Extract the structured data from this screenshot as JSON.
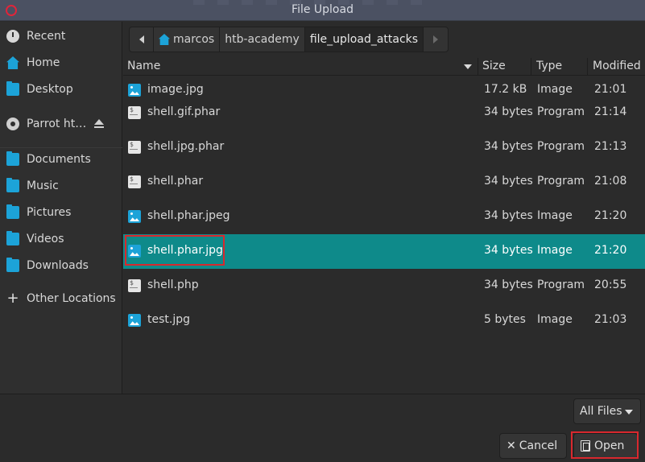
{
  "window": {
    "title": "File Upload"
  },
  "sidebar": {
    "items": [
      {
        "label": "Recent",
        "icon": "recent-icon"
      },
      {
        "label": "Home",
        "icon": "home-icon"
      },
      {
        "label": "Desktop",
        "icon": "folder-icon"
      },
      {
        "label": "Parrot ht…",
        "icon": "disc-icon"
      },
      {
        "label": "Documents",
        "icon": "folder-icon"
      },
      {
        "label": "Music",
        "icon": "folder-icon"
      },
      {
        "label": "Pictures",
        "icon": "folder-icon"
      },
      {
        "label": "Videos",
        "icon": "folder-icon"
      },
      {
        "label": "Downloads",
        "icon": "folder-icon"
      },
      {
        "label": "Other Locations",
        "icon": "plus-icon"
      }
    ]
  },
  "pathbar": {
    "segments": [
      "marcos",
      "htb-academy",
      "file_upload_attacks"
    ]
  },
  "columns": {
    "name": "Name",
    "size": "Size",
    "type": "Type",
    "modified": "Modified"
  },
  "files": [
    {
      "name": "image.jpg",
      "size": "17.2 kB",
      "type": "Image",
      "modified": "21:01",
      "icon": "image-icon"
    },
    {
      "name": "shell.gif.phar",
      "size": "34 bytes",
      "type": "Program",
      "modified": "21:14",
      "icon": "program-icon"
    },
    {
      "name": "shell.jpg.phar",
      "size": "34 bytes",
      "type": "Program",
      "modified": "21:13",
      "icon": "program-icon"
    },
    {
      "name": "shell.phar",
      "size": "34 bytes",
      "type": "Program",
      "modified": "21:08",
      "icon": "program-icon"
    },
    {
      "name": "shell.phar.jpeg",
      "size": "34 bytes",
      "type": "Image",
      "modified": "21:20",
      "icon": "image-icon"
    },
    {
      "name": "shell.phar.jpg",
      "size": "34 bytes",
      "type": "Image",
      "modified": "21:20",
      "icon": "image-icon",
      "selected": true
    },
    {
      "name": "shell.php",
      "size": "34 bytes",
      "type": "Program",
      "modified": "20:55",
      "icon": "program-icon"
    },
    {
      "name": "test.jpg",
      "size": "5 bytes",
      "type": "Image",
      "modified": "21:03",
      "icon": "image-icon"
    }
  ],
  "footer": {
    "filter_label": "All Files",
    "cancel_label": "Cancel",
    "open_label": "Open"
  },
  "colors": {
    "accent": "#1ca3d8",
    "selection": "#0e8a8a",
    "annotation": "#d8282e"
  }
}
